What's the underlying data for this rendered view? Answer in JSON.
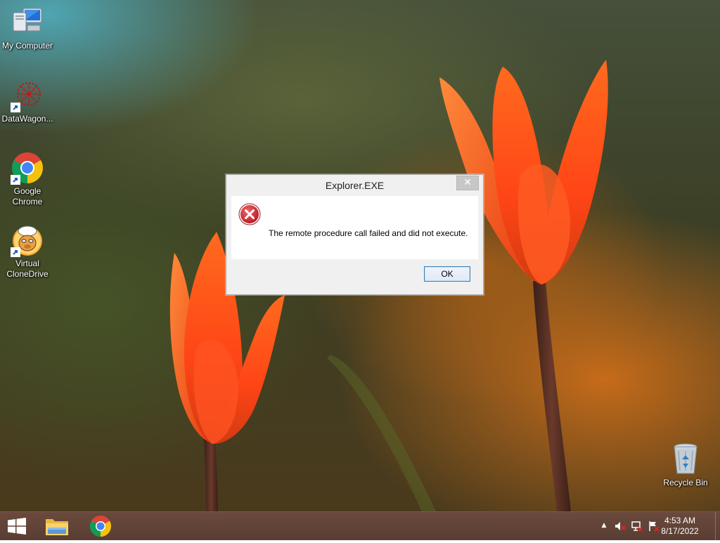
{
  "desktop": {
    "icons": [
      {
        "label": "My Computer",
        "icon": "computer-icon"
      },
      {
        "label": "DataWagon...",
        "icon": "datawagon-icon",
        "shortcut": true
      },
      {
        "label": "Google Chrome",
        "icon": "chrome-icon",
        "shortcut": true
      },
      {
        "label": "Virtual CloneDrive",
        "icon": "clonedrive-sheep-icon",
        "shortcut": true
      },
      {
        "label": "Recycle Bin",
        "icon": "recycle-bin-icon"
      }
    ]
  },
  "dialog": {
    "title": "Explorer.EXE",
    "close_glyph": "✕",
    "message": "The remote procedure call failed and did not execute.",
    "ok_label": "OK",
    "icon": "error-icon"
  },
  "taskbar": {
    "start_icon": "windows-logo-icon",
    "pinned": [
      {
        "name": "File Explorer",
        "icon": "folder-icon"
      },
      {
        "name": "Google Chrome",
        "icon": "chrome-icon"
      }
    ],
    "tray": {
      "overflow_glyph": "▲",
      "icons": [
        "volume-muted-icon",
        "network-icon",
        "action-center-flag-icon"
      ]
    },
    "clock": {
      "time": "4:53 AM",
      "date": "8/17/2022"
    }
  },
  "colors": {
    "taskbar": "#5e4135",
    "dialog_bg": "#f0f0f0",
    "error_red": "#c4262e",
    "ok_border": "#3c7fb1"
  }
}
